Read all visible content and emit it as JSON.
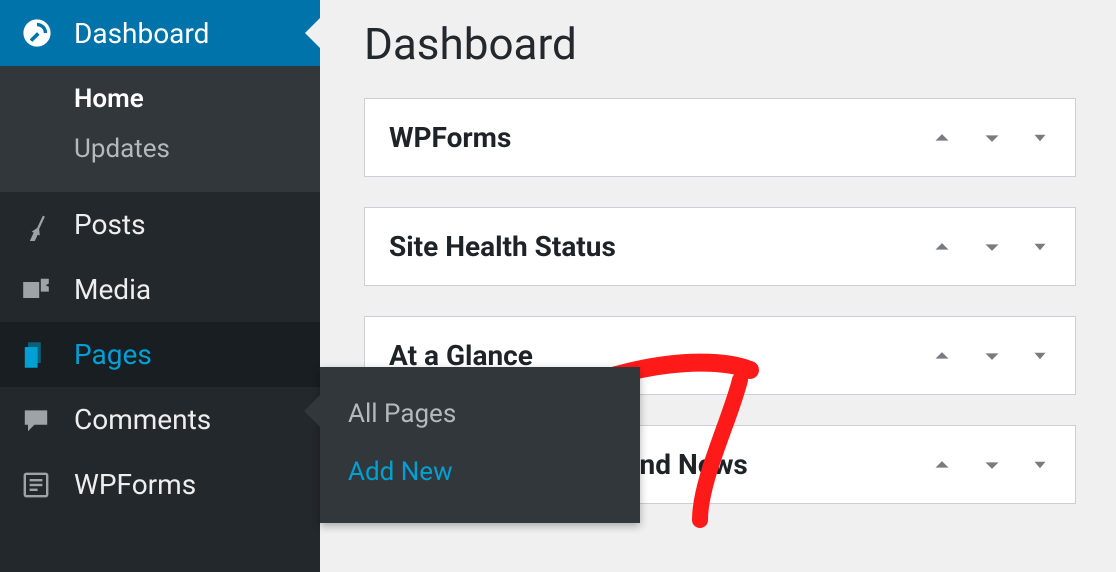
{
  "sidebar": {
    "dashboard": {
      "label": "Dashboard"
    },
    "submenu": {
      "home": "Home",
      "updates": "Updates"
    },
    "items": [
      {
        "label": "Posts"
      },
      {
        "label": "Media"
      },
      {
        "label": "Pages"
      },
      {
        "label": "Comments"
      },
      {
        "label": "WPForms"
      }
    ]
  },
  "flyout": {
    "all_pages": "All Pages",
    "add_new": "Add New"
  },
  "content": {
    "title": "Dashboard",
    "widgets": [
      {
        "title": "WPForms"
      },
      {
        "title": "Site Health Status"
      },
      {
        "title": "At a Glance"
      },
      {
        "title": "WordPress Events and News"
      }
    ]
  }
}
